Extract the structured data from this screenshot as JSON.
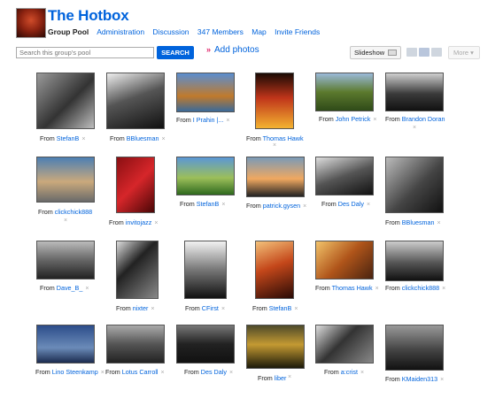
{
  "group": {
    "title": "The Hotbox",
    "nav": [
      "Group Pool",
      "Administration",
      "Discussion",
      "347 Members",
      "Map",
      "Invite Friends"
    ]
  },
  "toolbar": {
    "search_placeholder": "Search this group's pool",
    "search_label": "SEARCH",
    "add_photos_label": "Add photos",
    "add_photos_chevron": "»",
    "slideshow_label": "Slideshow",
    "more_label": "More ▾"
  },
  "photos": [
    {
      "from": "From",
      "user": "StefanB",
      "remove": "×"
    },
    {
      "from": "From",
      "user": "BBluesman",
      "remove": "×"
    },
    {
      "from": "From",
      "user": "I Prahin |...",
      "remove": "×"
    },
    {
      "from": "From",
      "user": "Thomas Hawk",
      "remove": "×"
    },
    {
      "from": "From",
      "user": "John Petrick",
      "remove": "×"
    },
    {
      "from": "From",
      "user": "Brandon Doran",
      "remove": "×"
    },
    {
      "from": "From",
      "user": "clickchick888",
      "remove": "×"
    },
    {
      "from": "From",
      "user": "invitojazz",
      "remove": "×"
    },
    {
      "from": "From",
      "user": "StefanB",
      "remove": "×"
    },
    {
      "from": "From",
      "user": "patrick.gysen",
      "remove": "×"
    },
    {
      "from": "From",
      "user": "Des Daly",
      "remove": "×"
    },
    {
      "from": "From",
      "user": "BBluesman",
      "remove": "×"
    },
    {
      "from": "From",
      "user": "Dave_B_",
      "remove": "×"
    },
    {
      "from": "From",
      "user": "nixter",
      "remove": "×"
    },
    {
      "from": "From",
      "user": "CFirst",
      "remove": "×"
    },
    {
      "from": "From",
      "user": "StefanB",
      "remove": "×"
    },
    {
      "from": "From",
      "user": "Thomas Hawk",
      "remove": "×"
    },
    {
      "from": "From",
      "user": "clickchick888",
      "remove": "×"
    },
    {
      "from": "From",
      "user": "Lino Steenkamp",
      "remove": "×"
    },
    {
      "from": "From",
      "user": "Lotus Carroll",
      "remove": "×"
    },
    {
      "from": "From",
      "user": "Des Daly",
      "remove": "×"
    },
    {
      "from": "From",
      "user": "liber",
      "remove": "×"
    },
    {
      "from": "From",
      "user": "a:crist",
      "remove": "×"
    },
    {
      "from": "From",
      "user": "KMaiden313",
      "remove": "×"
    }
  ]
}
